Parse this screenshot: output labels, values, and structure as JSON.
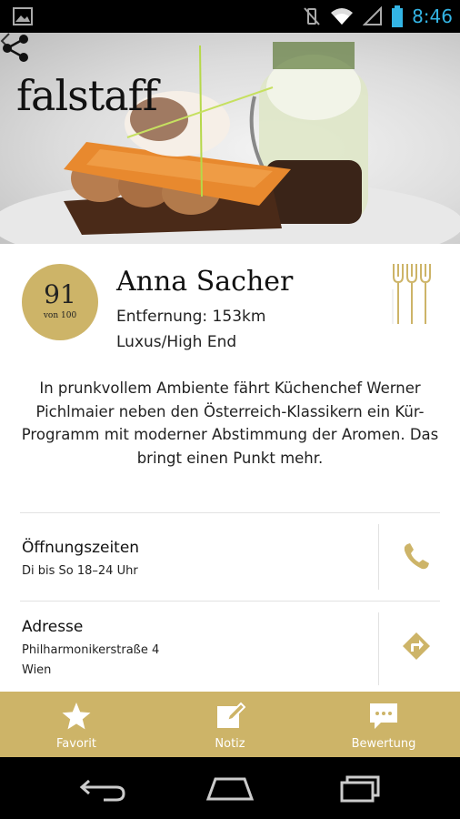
{
  "status_bar": {
    "time": "8:46"
  },
  "header": {
    "logo": "falstaff"
  },
  "restaurant": {
    "score": "91",
    "score_sub": "von 100",
    "name": "Anna Sacher",
    "distance": "Entfernung: 153km",
    "category": "Luxus/High End",
    "description": "In prunkvollem Ambiente fährt Küchenchef Werner Pichlmaier neben den Österreich-Klassikern ein Kür-Programm mit moderner Abstimmung der Aromen. Das bringt einen Punkt mehr."
  },
  "opening": {
    "title": "Öffnungszeiten",
    "value": "Di bis So 18–24 Uhr"
  },
  "address": {
    "title": "Adresse",
    "street": "Philharmonikerstraße 4",
    "city": "Wien"
  },
  "tabs": [
    {
      "label": "Favorit",
      "icon": "star-icon"
    },
    {
      "label": "Notiz",
      "icon": "note-icon"
    },
    {
      "label": "Bewertung",
      "icon": "chat-icon"
    }
  ],
  "colors": {
    "accent": "#cdb468",
    "status_time": "#33b5e5"
  }
}
